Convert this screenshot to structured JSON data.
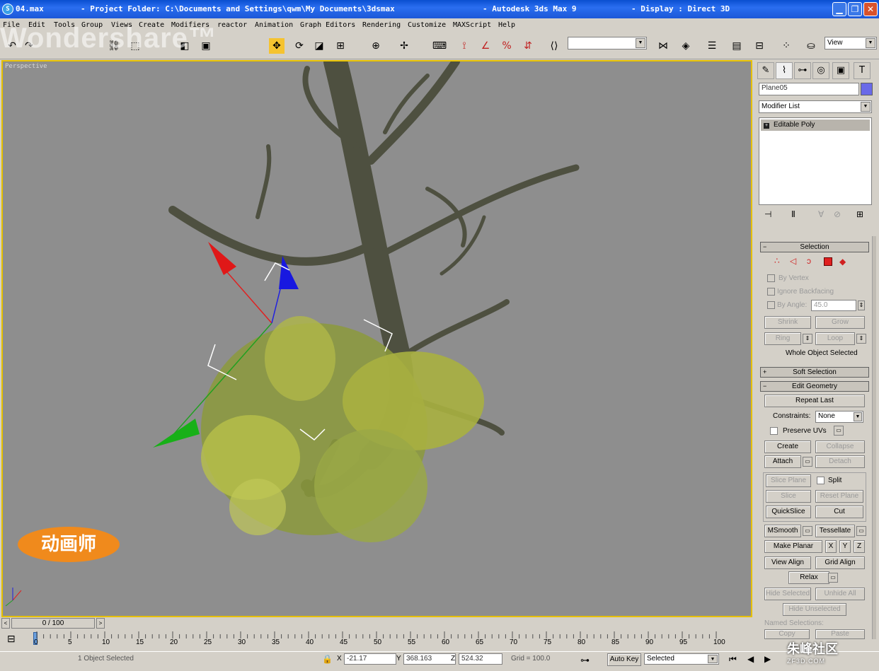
{
  "window": {
    "icon_label": "S",
    "file": "04.max",
    "project_folder": "- Project Folder: C:\\Documents and Settings\\qwm\\My Documents\\3dsmax",
    "app": "- Autodesk 3ds Max 9",
    "display": "- Display : Direct 3D"
  },
  "menu": [
    "File",
    "Edit",
    "Tools",
    "Group",
    "Views",
    "Create",
    "Modifiers",
    "reactor",
    "Animation",
    "Graph Editors",
    "Rendering",
    "Customize",
    "MAXScript",
    "Help"
  ],
  "toolbar": {
    "view_dropdown": "View",
    "selection_set": ""
  },
  "watermark": "Wondershare™",
  "viewport": {
    "label": "Perspective",
    "badge": "动画师"
  },
  "command_panel": {
    "object_name": "Plane05",
    "object_color": "#6a6ae8",
    "modifier_list": "Modifier List",
    "stack": [
      "Editable Poly"
    ],
    "selection": {
      "title": "Selection",
      "by_vertex": "By Vertex",
      "ignore_backfacing": "Ignore Backfacing",
      "by_angle": "By Angle:",
      "angle_value": "45.0",
      "shrink": "Shrink",
      "grow": "Grow",
      "ring": "Ring",
      "loop": "Loop",
      "status": "Whole Object Selected"
    },
    "soft_selection": "Soft Selection",
    "edit_geometry": {
      "title": "Edit Geometry",
      "repeat_last": "Repeat Last",
      "constraints_label": "Constraints:",
      "constraints_value": "None",
      "preserve_uvs": "Preserve UVs",
      "create": "Create",
      "collapse": "Collapse",
      "attach": "Attach",
      "detach": "Detach",
      "slice_plane": "Slice Plane",
      "split": "Split",
      "slice": "Slice",
      "reset_plane": "Reset Plane",
      "quickslice": "QuickSlice",
      "cut": "Cut",
      "msmooth": "MSmooth",
      "tessellate": "Tessellate",
      "make_planar": "Make Planar",
      "x": "X",
      "y": "Y",
      "z": "Z",
      "view_align": "View Align",
      "grid_align": "Grid Align",
      "relax": "Relax",
      "hide_selected": "Hide Selected",
      "unhide_all": "Unhide All",
      "hide_unselected": "Hide Unselected",
      "named_selections": "Named Selections:",
      "copy": "Copy",
      "paste": "Paste"
    }
  },
  "timeline": {
    "frame": "0 / 100",
    "ticks": [
      "0",
      "5",
      "10",
      "15",
      "20",
      "25",
      "30",
      "35",
      "40",
      "45",
      "50",
      "55",
      "60",
      "65",
      "70",
      "75",
      "80",
      "85",
      "90",
      "95",
      "100"
    ]
  },
  "status": {
    "selected": "1 Object Selected",
    "x_label": "X",
    "x": "-21.17",
    "y_label": "Y",
    "y": "368.163",
    "z_label": "Z",
    "z": "524.32",
    "grid": "Grid = 100.0",
    "auto_key": "Auto Key",
    "selected_dropdown": "Selected"
  },
  "corner_watermark": {
    "text": "朱峰社区",
    "sub": "ZF3D.COM"
  },
  "colors": {
    "titlebar": "#1c58d8",
    "viewport_bg": "#8e8e8e",
    "viewport_border": "#e6c000",
    "badge": "#f08a1c"
  }
}
